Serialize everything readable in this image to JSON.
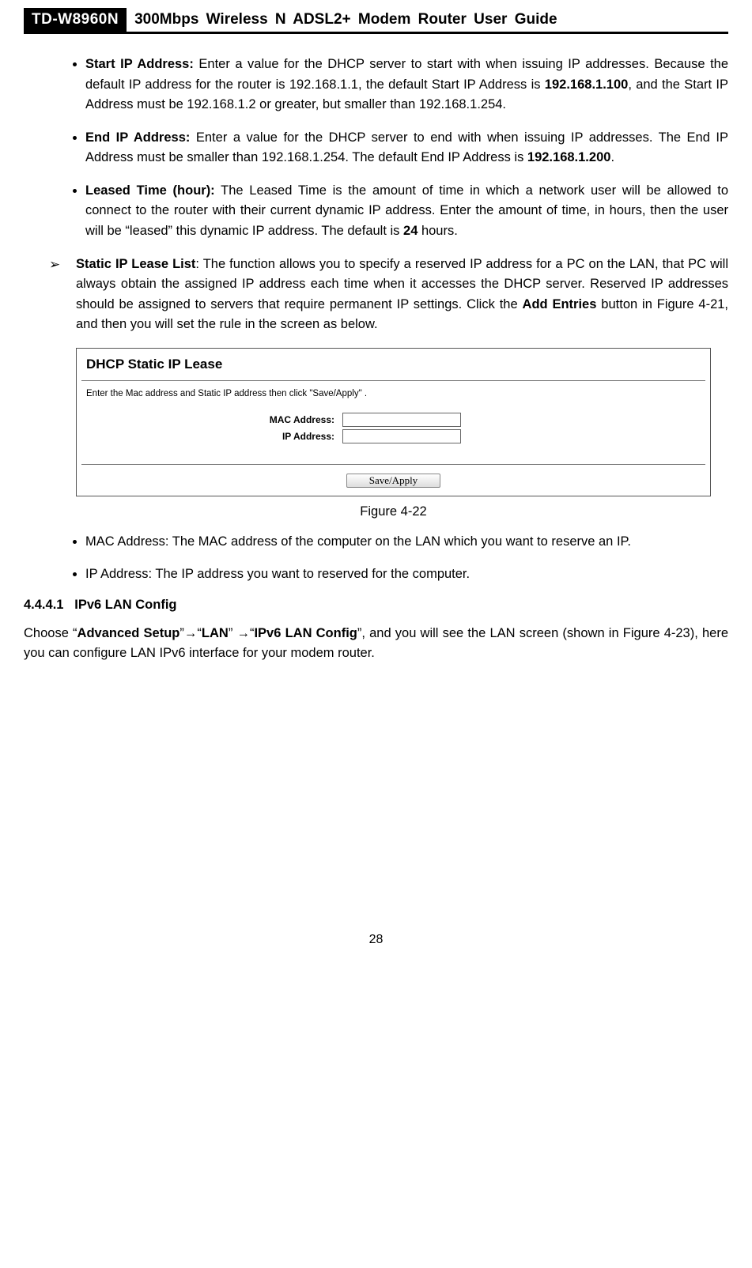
{
  "header": {
    "model": "TD-W8960N",
    "title": "300Mbps Wireless N ADSL2+ Modem Router User Guide"
  },
  "bullets_top": {
    "start_ip": {
      "label": "Start IP Address:",
      "text_a": " Enter a value for the DHCP server to start with when issuing IP addresses. Because the default IP address for the router is 192.168.1.1, the default Start IP Address is ",
      "bold_a": "192.168.1.100",
      "text_b": ", and the Start IP Address must be 192.168.1.2 or greater, but smaller than 192.168.1.254."
    },
    "end_ip": {
      "label": "End IP Address:",
      "text_a": " Enter a value for the DHCP server to end with when issuing IP addresses. The End IP Address must be smaller than 192.168.1.254. The default End IP Address is ",
      "bold_a": "192.168.1.200",
      "text_b": "."
    },
    "leased": {
      "label": "Leased Time (hour):",
      "text_a": " The Leased Time is the amount of time in which a network user will be allowed to connect to the router with their current dynamic IP address. Enter the amount of time, in hours, then the user will be “leased” this dynamic IP address. The default is ",
      "bold_a": "24",
      "text_b": " hours."
    }
  },
  "arrowed": {
    "label": "Static IP Lease List",
    "text_a": ": The function allows you to specify a reserved IP address for a PC on the LAN, that PC will always obtain the assigned IP address each time when it accesses the DHCP server. Reserved IP addresses should be assigned to servers that require permanent IP settings. Click the ",
    "bold_a": "Add Entries",
    "text_b": " button in Figure 4-21, and then you will set the rule in the screen as below."
  },
  "screenshot": {
    "title": "DHCP Static IP Lease",
    "instr": "Enter the Mac address and Static IP address then click \"Save/Apply\" .",
    "mac_label": "MAC Address:",
    "ip_label": "IP Address:",
    "mac_value": "",
    "ip_value": "",
    "button": "Save/Apply"
  },
  "figure_caption": "Figure 4-22",
  "bullets_bottom": {
    "mac": "MAC Address: The MAC address of the computer on the LAN which you want to reserve an IP.",
    "ip": "IP Address: The IP address you want to reserved for the computer."
  },
  "section": {
    "num": "4.4.4.1",
    "title": "IPv6 LAN Config"
  },
  "nav_para": {
    "a": "Choose “",
    "b1": "Advanced Setup",
    "c": "”→“",
    "b2": "LAN",
    "d": "” →“",
    "b3": "IPv6 LAN Config",
    "e": "”, and you will see the LAN screen (shown in Figure 4-23), here you can configure LAN IPv6 interface for your modem router."
  },
  "page_number": "28"
}
